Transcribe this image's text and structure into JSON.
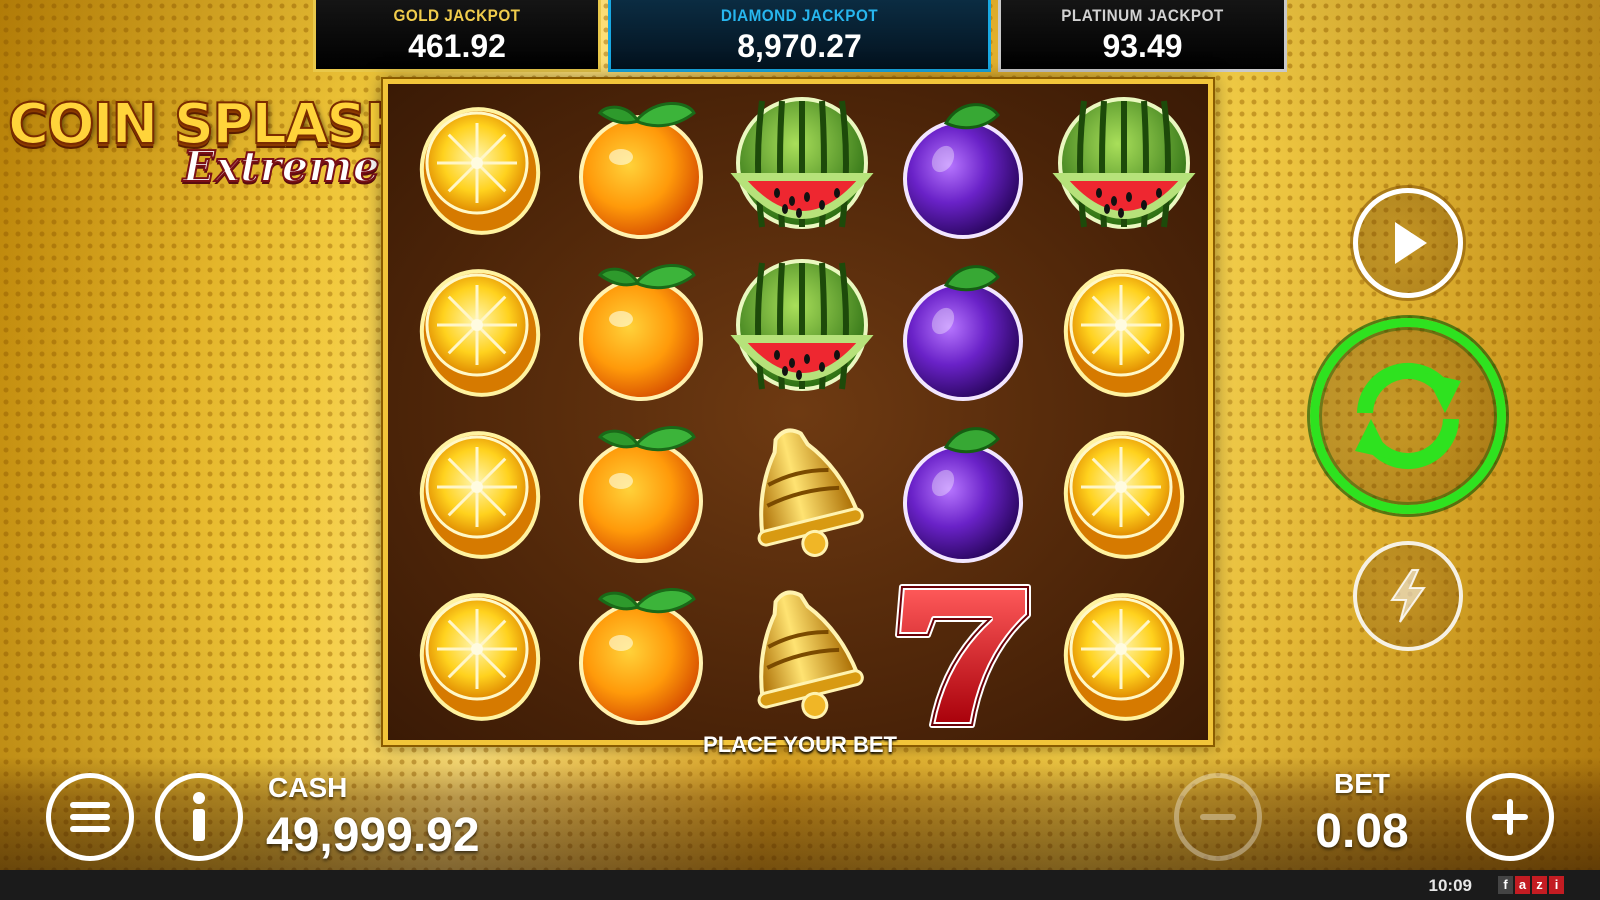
{
  "jackpots": {
    "gold": {
      "label": "GOLD JACKPOT",
      "value": "461.92"
    },
    "diamond": {
      "label": "DIAMOND JACKPOT",
      "value": "8,970.27"
    },
    "platinum": {
      "label": "PLATINUM JACKPOT",
      "value": "93.49"
    }
  },
  "logo": {
    "title": "COIN SPLASH",
    "subtitle": "Extreme"
  },
  "reels": {
    "rows": [
      [
        "lemon",
        "orange",
        "watermelon",
        "plum",
        "watermelon"
      ],
      [
        "lemon",
        "orange",
        "watermelon",
        "plum",
        "lemon"
      ],
      [
        "lemon",
        "orange",
        "bell",
        "plum",
        "lemon"
      ],
      [
        "lemon",
        "orange",
        "bell",
        "seven",
        "lemon"
      ]
    ]
  },
  "message": "PLACE YOUR BET",
  "controls": {
    "play_icon": "play-icon",
    "spin_icon": "spin-refresh-icon",
    "turbo_icon": "lightning-icon",
    "spin_color": "#2ee21f"
  },
  "cash": {
    "label": "CASH",
    "value": "49,999.92"
  },
  "bet": {
    "label": "BET",
    "value": "0.08"
  },
  "status": {
    "time": "10:09",
    "brand_letters": [
      "f",
      "a",
      "z",
      "i"
    ]
  }
}
